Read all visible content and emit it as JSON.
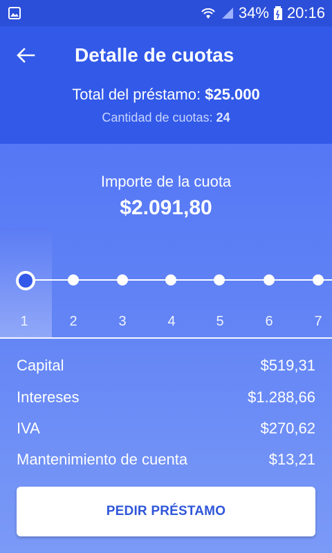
{
  "status_bar": {
    "battery": "34%",
    "time": "20:16",
    "icons": [
      "gallery-icon",
      "wifi-icon",
      "signal-icon",
      "battery-icon"
    ]
  },
  "header": {
    "back_icon": "back-arrow-icon",
    "title": "Detalle de cuotas",
    "total_label": "Total del préstamo:",
    "total_value": "$25.000",
    "count_label": "Cantidad de cuotas:",
    "count_value": "24"
  },
  "installment": {
    "label": "Importe de la cuota",
    "amount": "$2.091,80"
  },
  "timeline": {
    "selected_index": 0,
    "items": [
      "1",
      "2",
      "3",
      "4",
      "5",
      "6",
      "7"
    ]
  },
  "breakdown": [
    {
      "label": "Capital",
      "value": "$519,31"
    },
    {
      "label": "Intereses",
      "value": "$1.288,66"
    },
    {
      "label": "IVA",
      "value": "$270,62"
    },
    {
      "label": "Mantenimiento de cuenta",
      "value": "$13,21"
    }
  ],
  "cta": {
    "label": "PEDIR PRÉSTAMO"
  },
  "colors": {
    "status_bar": "#2c4fd9",
    "header": "#3259e8",
    "content_top": "#4a6cf5",
    "content_bottom": "#7b9af7",
    "button_text": "#2f56d8"
  }
}
